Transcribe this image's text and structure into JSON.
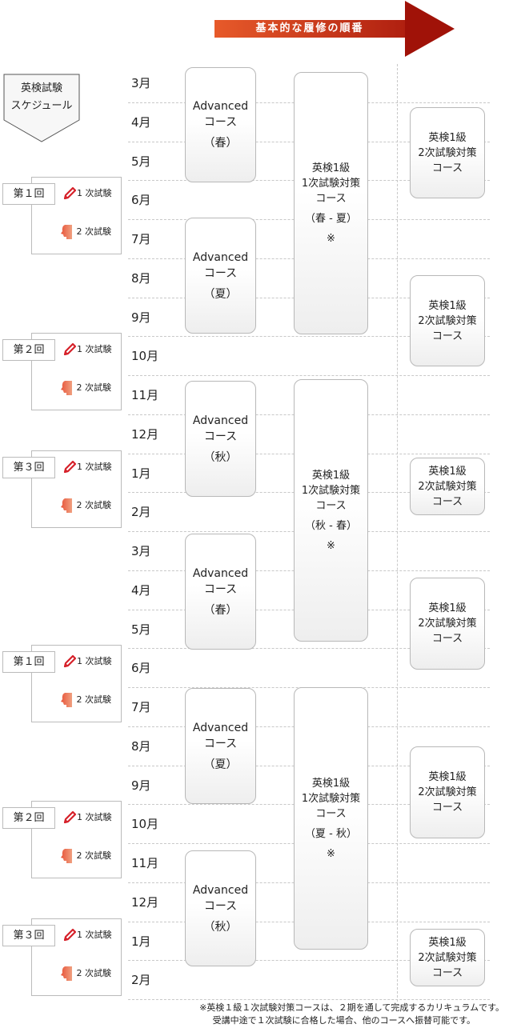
{
  "header": {
    "arrow_label": "基本的な履修の順番",
    "arrow_color_start": "#e75a2a",
    "arrow_color_end": "#a01208"
  },
  "schedule_label": [
    "英検試験",
    "スケジュール"
  ],
  "months": [
    "3月",
    "4月",
    "5月",
    "6月",
    "7月",
    "8月",
    "9月",
    "10月",
    "11月",
    "12月",
    "1月",
    "2月",
    "3月",
    "4月",
    "5月",
    "6月",
    "7月",
    "8月",
    "9月",
    "10月",
    "11月",
    "12月",
    "1月",
    "2月"
  ],
  "exam_groups": [
    {
      "round": "第１回",
      "first": "1 次試験",
      "second": "2 次試験",
      "start_month_index": 3
    },
    {
      "round": "第２回",
      "first": "1 次試験",
      "second": "2 次試験",
      "start_month_index": 7
    },
    {
      "round": "第３回",
      "first": "1 次試験",
      "second": "2 次試験",
      "start_month_index": 10
    },
    {
      "round": "第１回",
      "first": "1 次試験",
      "second": "2 次試験",
      "start_month_index": 15
    },
    {
      "round": "第２回",
      "first": "1 次試験",
      "second": "2 次試験",
      "start_month_index": 19
    },
    {
      "round": "第３回",
      "first": "1 次試験",
      "second": "2 次試験",
      "start_month_index": 22
    }
  ],
  "advanced_courses": [
    {
      "title": "Advanced",
      "sub": "コース",
      "season": "（春）"
    },
    {
      "title": "Advanced",
      "sub": "コース",
      "season": "（夏）"
    },
    {
      "title": "Advanced",
      "sub": "コース",
      "season": "（秋）"
    },
    {
      "title": "Advanced",
      "sub": "コース",
      "season": "（春）"
    },
    {
      "title": "Advanced",
      "sub": "コース",
      "season": "（夏）"
    },
    {
      "title": "Advanced",
      "sub": "コース",
      "season": "（秋）"
    }
  ],
  "first_exam_courses": [
    {
      "line1": "英検1級",
      "line2": "1次試験対策",
      "line3": "コース",
      "period": "（春 - 夏）",
      "mark": "※"
    },
    {
      "line1": "英検1級",
      "line2": "1次試験対策",
      "line3": "コース",
      "period": "（秋 - 春）",
      "mark": "※"
    },
    {
      "line1": "英検1級",
      "line2": "1次試験対策",
      "line3": "コース",
      "period": "（夏 - 秋）",
      "mark": "※"
    }
  ],
  "second_exam_courses": [
    {
      "line1": "英検1級",
      "line2": "2次試験対策",
      "line3": "コース"
    },
    {
      "line1": "英検1級",
      "line2": "2次試験対策",
      "line3": "コース"
    },
    {
      "line1": "英検1級",
      "line2": "2次試験対策",
      "line3": "コース"
    },
    {
      "line1": "英検1級",
      "line2": "2次試験対策",
      "line3": "コース"
    },
    {
      "line1": "英検1級",
      "line2": "2次試験対策",
      "line3": "コース"
    },
    {
      "line1": "英検1級",
      "line2": "2次試験対策",
      "line3": "コース"
    }
  ],
  "footnote": [
    "※英検１級１次試験対策コースは、２期を通して完成するカリキュラムです。",
    "受講中途で１次試験に合格した場合、他のコースへ振替可能です。"
  ]
}
